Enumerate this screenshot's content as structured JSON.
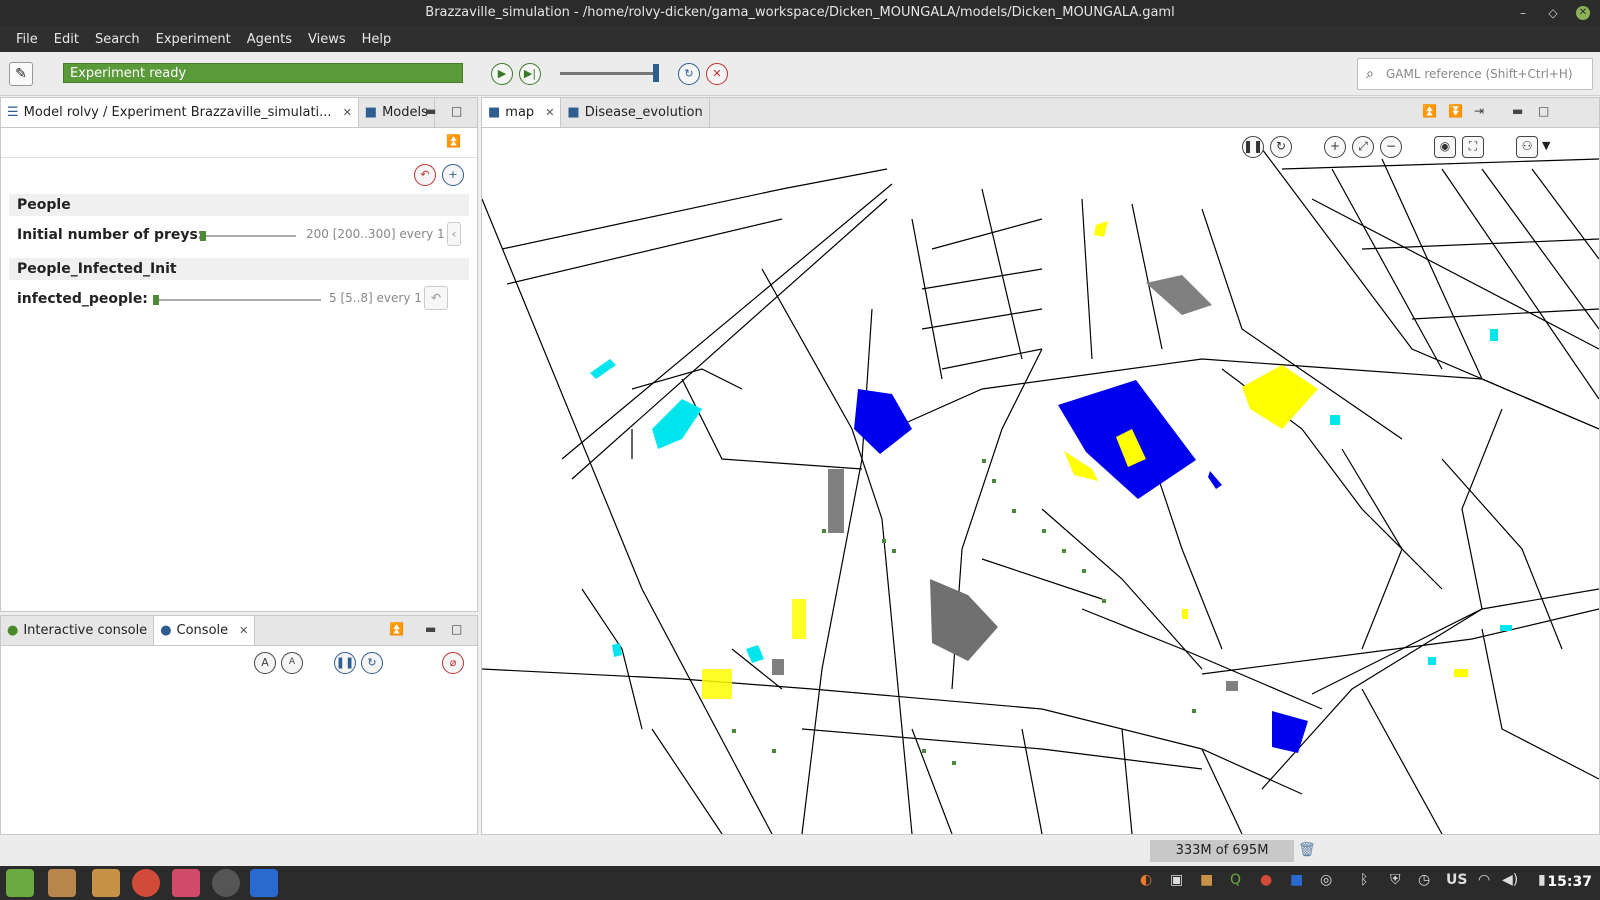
{
  "window": {
    "title": "Brazzaville_simulation - /home/rolvy-dicken/gama_workspace/Dicken_MOUNGALA/models/Dicken_MOUNGALA.gaml"
  },
  "menu": [
    "File",
    "Edit",
    "Search",
    "Experiment",
    "Agents",
    "Views",
    "Help"
  ],
  "toolbar": {
    "status_text": "Experiment ready",
    "search_placeholder": "GAML reference (Shift+Ctrl+H)",
    "speed_level": 1.0
  },
  "left_panel": {
    "tabs": [
      {
        "label": "Model rolvy / Experiment Brazzaville_simulati...",
        "closable": true
      },
      {
        "label": "Models",
        "closable": false
      }
    ],
    "sections": [
      {
        "title": "People",
        "param": {
          "label": "Initial number of preys:",
          "value": "200 [200..300] every 1",
          "level": 0.0
        }
      },
      {
        "title": "People_Infected_Init",
        "param": {
          "label": "infected_people:",
          "value": "5 [5..8] every 1",
          "level": 0.0
        }
      }
    ]
  },
  "console_panel": {
    "tabs": [
      {
        "label": "Interactive console",
        "closable": false
      },
      {
        "label": "Console",
        "closable": true
      }
    ]
  },
  "map_panel": {
    "tabs": [
      {
        "label": "map",
        "closable": true
      },
      {
        "label": "Disease_evolution",
        "closable": false
      }
    ],
    "colors": {
      "roads": "#000000",
      "school_blue": "#0000ee",
      "yellow": "#ffff00",
      "cyan": "#00e5ee",
      "gray": "#808080",
      "green_agents": "#4a8a3a"
    }
  },
  "memory": {
    "readout": "333M of 695M"
  },
  "taskbar": {
    "keyboard_layout": "US",
    "clock": "15:37"
  }
}
